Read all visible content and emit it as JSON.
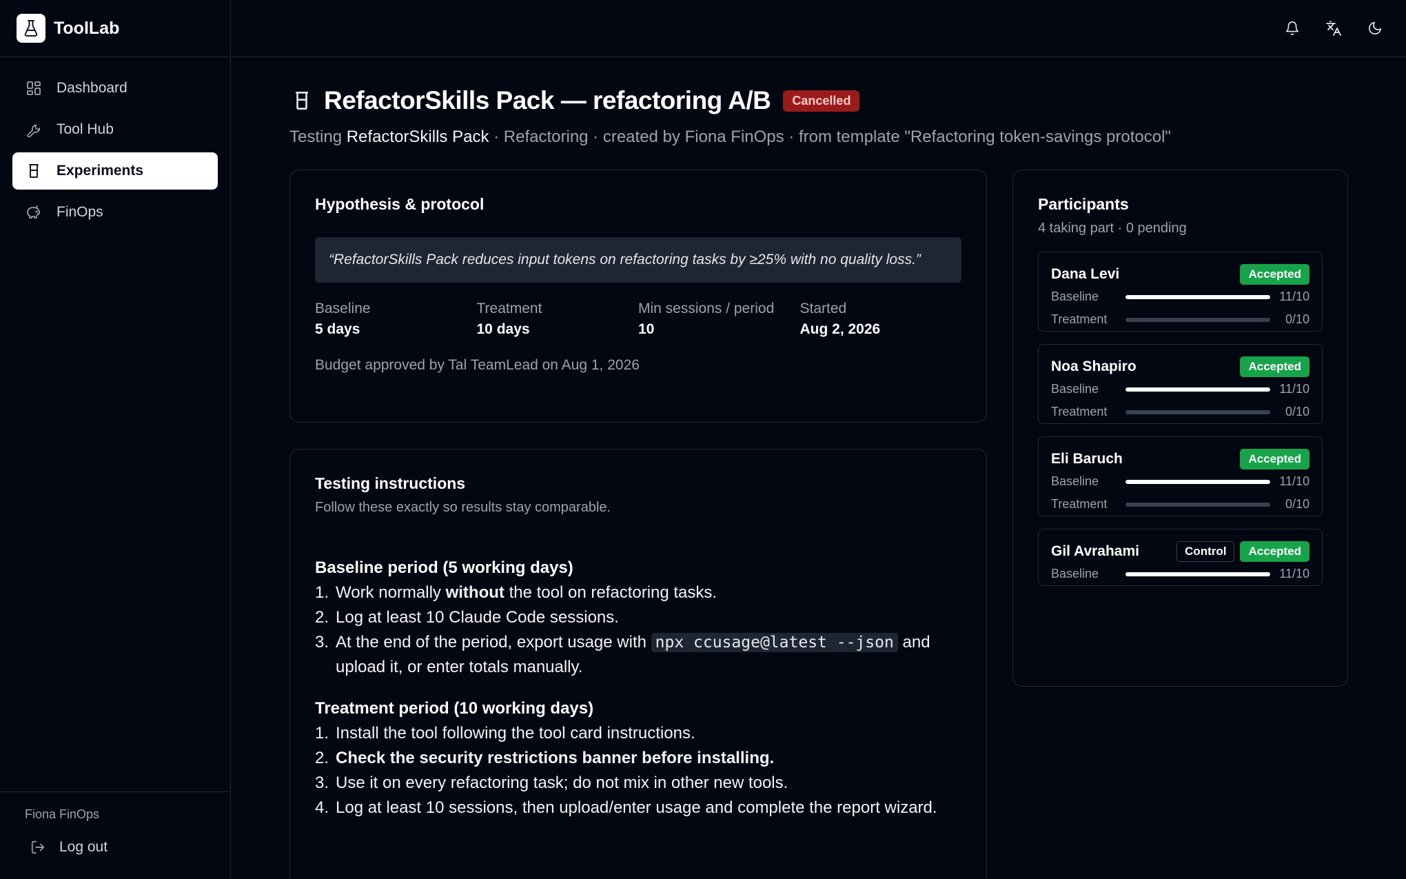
{
  "app": {
    "name": "ToolLab"
  },
  "nav": [
    {
      "label": "Dashboard",
      "icon": "dashboard-icon",
      "active": false
    },
    {
      "label": "Tool Hub",
      "icon": "wrench-icon",
      "active": false
    },
    {
      "label": "Experiments",
      "icon": "beaker-icon",
      "active": true
    },
    {
      "label": "FinOps",
      "icon": "piggy-bank-icon",
      "active": false
    }
  ],
  "user": {
    "name": "Fiona FinOps",
    "logout_label": "Log out"
  },
  "header": {
    "title": "RefactorSkills Pack — refactoring A/B",
    "status": "Cancelled",
    "status_color": "#991b1b",
    "subtitle_prefix": "Testing",
    "subtitle_tool": "RefactorSkills Pack",
    "subtitle_rest": " · Refactoring · created by Fiona FinOps · from template \"Refactoring token-savings protocol\""
  },
  "hypothesis": {
    "title": "Hypothesis & protocol",
    "quote": "“RefactorSkills Pack reduces input tokens on refactoring tasks by ≥25% with no quality loss.”",
    "stats": [
      {
        "label": "Baseline",
        "value": "5 days"
      },
      {
        "label": "Treatment",
        "value": "10 days"
      },
      {
        "label": "Min sessions / period",
        "value": "10"
      },
      {
        "label": "Started",
        "value": "Aug 2, 2026"
      }
    ],
    "budget": "Budget approved by Tal TeamLead on Aug 1, 2026"
  },
  "instructions": {
    "title": "Testing instructions",
    "subtitle": "Follow these exactly so results stay comparable.",
    "baseline_head": "Baseline period (5 working days)",
    "baseline": {
      "s1_pre": "Work normally ",
      "s1_bold": "without",
      "s1_post": " the tool on refactoring tasks.",
      "s2": "Log at least 10 Claude Code sessions.",
      "s3_pre": "At the end of the period, export usage with ",
      "s3_code": "npx ccusage@latest --json",
      "s3_post": " and upload it, or enter totals manually."
    },
    "treatment_head": "Treatment period (10 working days)",
    "treatment": {
      "s1": "Install the tool following the tool card instructions.",
      "s2": "Check the security restrictions banner before installing.",
      "s3": "Use it on every refactoring task; do not mix in other new tools.",
      "s4": "Log at least 10 sessions, then upload/enter usage and complete the report wizard."
    }
  },
  "participants": {
    "title": "Participants",
    "summary": "4 taking part · 0 pending",
    "accepted_color": "#16a34a",
    "list": [
      {
        "name": "Dana Levi",
        "status": "Accepted",
        "control": "",
        "baseline_label": "Baseline",
        "baseline_value": "11/10",
        "baseline_fill": 1.0,
        "treatment_label": "Treatment",
        "treatment_value": "0/10",
        "treatment_fill": 0.0
      },
      {
        "name": "Noa Shapiro",
        "status": "Accepted",
        "control": "",
        "baseline_label": "Baseline",
        "baseline_value": "11/10",
        "baseline_fill": 1.0,
        "treatment_label": "Treatment",
        "treatment_value": "0/10",
        "treatment_fill": 0.0
      },
      {
        "name": "Eli Baruch",
        "status": "Accepted",
        "control": "",
        "baseline_label": "Baseline",
        "baseline_value": "11/10",
        "baseline_fill": 1.0,
        "treatment_label": "Treatment",
        "treatment_value": "0/10",
        "treatment_fill": 0.0
      },
      {
        "name": "Gil Avrahami",
        "status": "Accepted",
        "control": "Control",
        "baseline_label": "Baseline",
        "baseline_value": "11/10",
        "baseline_fill": 1.0
      }
    ]
  }
}
